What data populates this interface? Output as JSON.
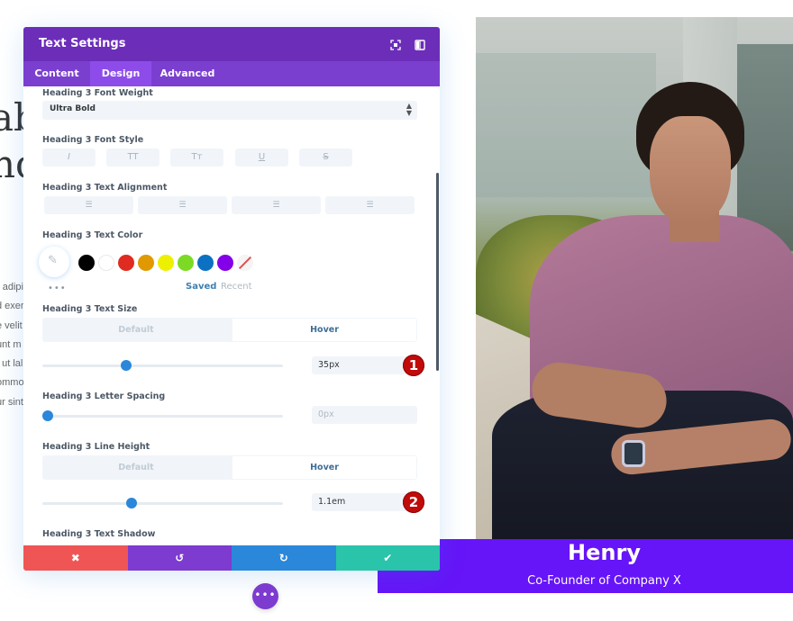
{
  "background_page": {
    "heading_fragments": [
      "ab",
      "nd"
    ],
    "paragraph_fragments": [
      "r adipi",
      "d exer",
      "e velit",
      "unt m",
      "t ut lal",
      "ommo",
      "ur sint"
    ]
  },
  "team_member": {
    "name": "Henry",
    "role": "Co-Founder of Company X",
    "overlay_color": "#6614f8"
  },
  "modal": {
    "title": "Text Settings",
    "header_icons": [
      "expand-icon",
      "split-view-icon"
    ],
    "tabs": [
      {
        "label": "Content",
        "active": false
      },
      {
        "label": "Design",
        "active": true
      },
      {
        "label": "Advanced",
        "active": false
      }
    ],
    "font_weight": {
      "label": "Heading 3 Font Weight",
      "value": "Ultra Bold"
    },
    "font_style": {
      "label": "Heading 3 Font Style",
      "buttons": [
        {
          "name": "italic",
          "glyph": "I"
        },
        {
          "name": "uppercase",
          "glyph": "TT"
        },
        {
          "name": "capitalize",
          "glyph": "Tт"
        },
        {
          "name": "underline",
          "glyph": "U"
        },
        {
          "name": "strikethrough",
          "glyph": "S"
        }
      ]
    },
    "text_alignment": {
      "label": "Heading 3 Text Alignment",
      "buttons": [
        {
          "name": "left",
          "glyph": "☰"
        },
        {
          "name": "center",
          "glyph": "☰"
        },
        {
          "name": "right",
          "glyph": "☰"
        },
        {
          "name": "justify",
          "glyph": "☰"
        }
      ]
    },
    "text_color": {
      "label": "Heading 3 Text Color",
      "swatches": [
        "#000000",
        "#ffffff",
        "#e02b20",
        "#e09900",
        "#edf000",
        "#7cda24",
        "#0c71c3",
        "#8300e9"
      ],
      "more_label": "•••",
      "saved_label": "Saved",
      "recent_label": "Recent"
    },
    "text_size": {
      "label": "Heading 3 Text Size",
      "toggle": {
        "default": "Default",
        "hover": "Hover",
        "active": "Hover"
      },
      "value": "35px",
      "slider_fraction": 0.35,
      "badge": "1"
    },
    "letter_spacing": {
      "label": "Heading 3 Letter Spacing",
      "value": "0px",
      "slider_fraction": 0.0
    },
    "line_height": {
      "label": "Heading 3 Line Height",
      "toggle": {
        "default": "Default",
        "hover": "Hover",
        "active": "Hover"
      },
      "value": "1.1em",
      "slider_fraction": 0.37,
      "badge": "2"
    },
    "text_shadow": {
      "label": "Heading 3 Text Shadow"
    },
    "footer": {
      "cancel": "✖",
      "undo": "↺",
      "redo": "↻",
      "save": "✔"
    }
  },
  "floating_more_button": "•••"
}
